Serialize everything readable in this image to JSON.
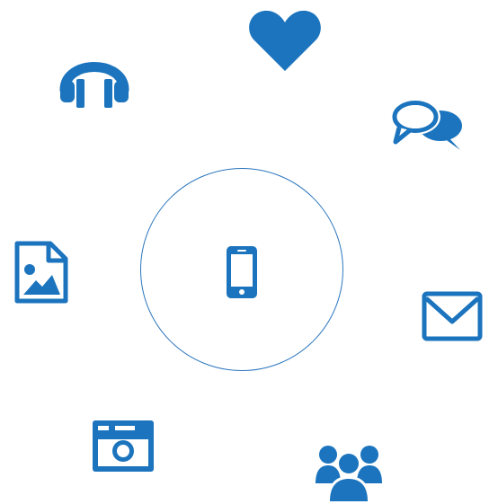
{
  "accent_color": "#1b74bd",
  "center": {
    "icon": "smartphone-icon"
  },
  "orbit_icons": [
    "heart-icon",
    "speech-bubbles-icon",
    "envelope-icon",
    "people-group-icon",
    "camera-icon",
    "image-file-icon",
    "headphones-icon"
  ]
}
